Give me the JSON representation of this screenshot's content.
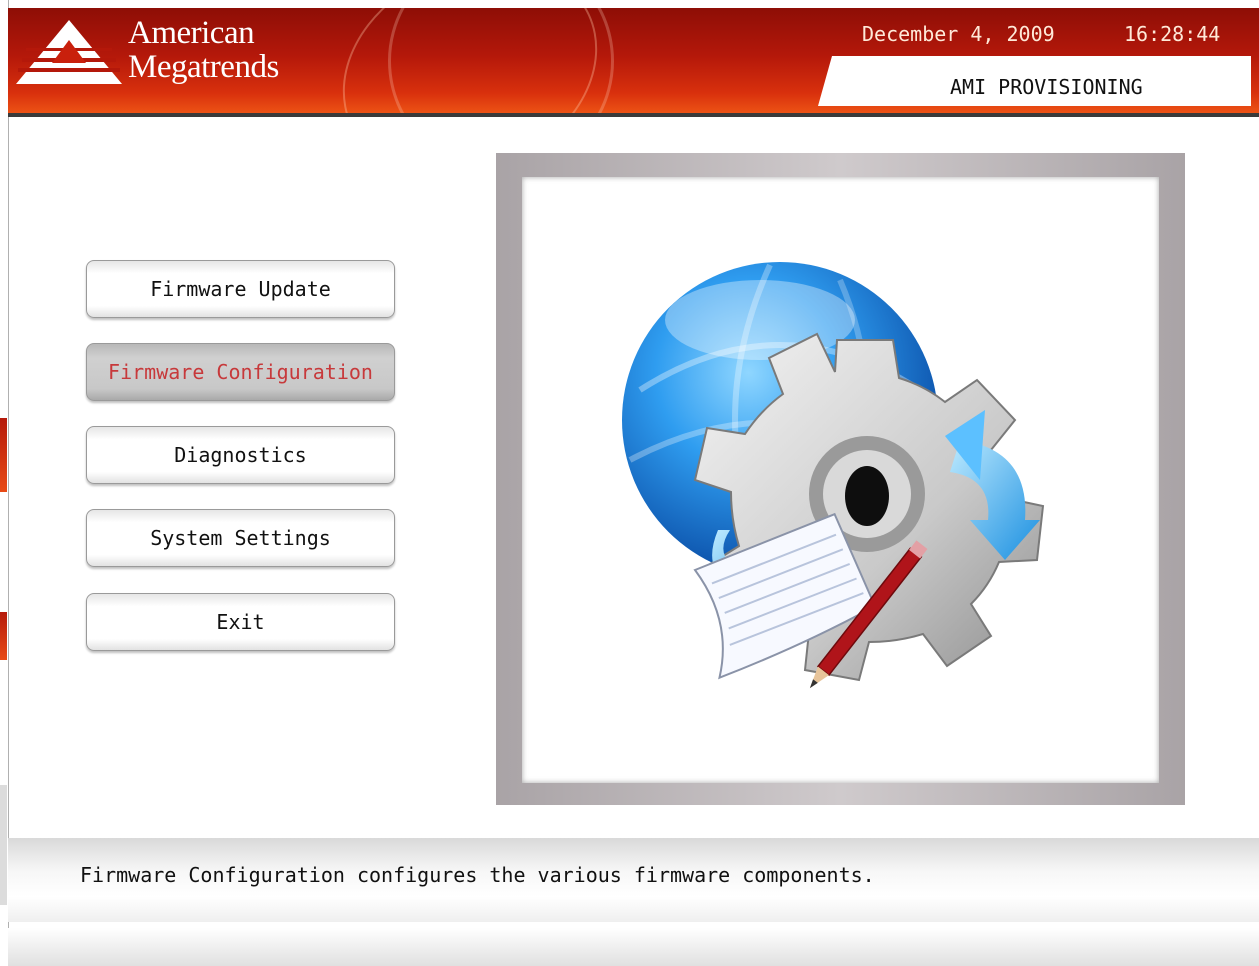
{
  "header": {
    "logo_line1": "American",
    "logo_line2": "Megatrends",
    "date": "December 4, 2009",
    "time": "16:28:44",
    "banner": "AMI PROVISIONING"
  },
  "menu": {
    "items": [
      {
        "label": "Firmware Update",
        "selected": false
      },
      {
        "label": "Firmware Configuration",
        "selected": true
      },
      {
        "label": "Diagnostics",
        "selected": false
      },
      {
        "label": "System Settings",
        "selected": false
      },
      {
        "label": "Exit",
        "selected": false
      }
    ]
  },
  "illustration": {
    "icon": "globe-gear-document-icon"
  },
  "status": {
    "description": "Firmware Configuration configures the various firmware components."
  },
  "colors": {
    "header_red": "#b4180a",
    "selected_text": "#c7393b",
    "frame_gray": "#b9b3b6"
  }
}
